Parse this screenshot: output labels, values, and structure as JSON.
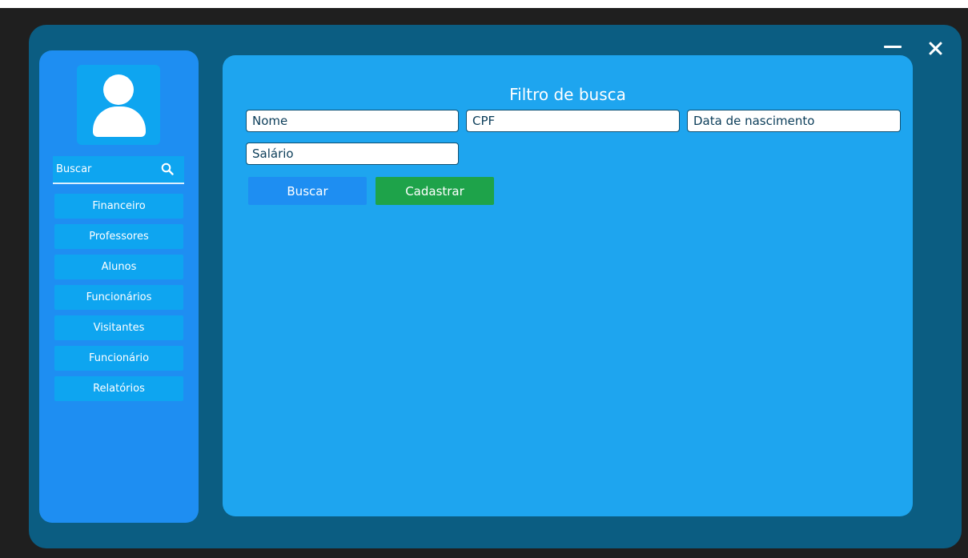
{
  "window": {
    "minimize_icon": "minimize-icon",
    "close_icon": "close-icon"
  },
  "sidebar": {
    "avatar_icon": "user-icon",
    "search": {
      "label": "Buscar",
      "icon": "search-icon"
    },
    "items": [
      {
        "label": "Financeiro"
      },
      {
        "label": "Professores"
      },
      {
        "label": "Alunos"
      },
      {
        "label": "Funcionários"
      },
      {
        "label": "Visitantes"
      },
      {
        "label": "Funcionário"
      },
      {
        "label": "Relatórios"
      }
    ]
  },
  "main": {
    "title": "Filtro de busca",
    "fields": {
      "nome": {
        "placeholder": "Nome"
      },
      "cpf": {
        "placeholder": "CPF"
      },
      "nascimento": {
        "placeholder": "Data de nascimento"
      },
      "salario": {
        "placeholder": "Salário"
      }
    },
    "buttons": {
      "buscar": "Buscar",
      "cadastrar": "Cadastrar"
    }
  },
  "colors": {
    "window_bg": "#0b5d82",
    "sidebar_bg": "#1e8ef2",
    "main_bg": "#1ea5ef",
    "nav_item_bg": "#0ea5f0",
    "buscar_button": "#1e8ef2",
    "cadastrar_button": "#1ea34a"
  }
}
